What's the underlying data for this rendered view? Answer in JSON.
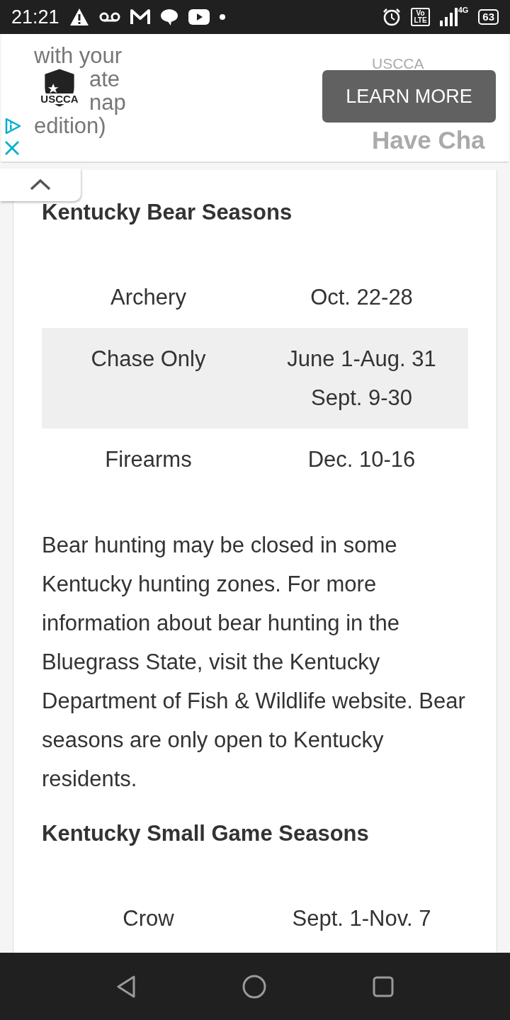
{
  "status_bar": {
    "time": "21:21",
    "volte_top": "Vo",
    "volte_bottom": "LTE",
    "network": "4G",
    "battery": "63"
  },
  "ad": {
    "text_lines": [
      "with your",
      "ate",
      "nap",
      "edition)"
    ],
    "logo_text": "USCCA",
    "advertiser": "USCCA",
    "headline": "Have Cha",
    "button": "LEARN MORE"
  },
  "sections": [
    {
      "heading": "Kentucky Bear Seasons",
      "rows": [
        {
          "name": "Archery",
          "dates": [
            "Oct. 22-28"
          ],
          "shaded": false
        },
        {
          "name": "Chase Only",
          "dates": [
            "June 1-Aug. 31",
            "Sept. 9-30"
          ],
          "shaded": true
        },
        {
          "name": "Firearms",
          "dates": [
            "Dec. 10-16"
          ],
          "shaded": false
        }
      ],
      "paragraph": "Bear hunting may be closed in some Kentucky hunting zones. For more information about bear hunting in the Bluegrass State, visit the Kentucky Department of Fish & Wildlife website. Bear seasons are only open to Kentucky residents."
    },
    {
      "heading": "Kentucky Small Game Seasons",
      "rows": [
        {
          "name": "Crow",
          "dates": [
            "Sept. 1-Nov. 7"
          ],
          "shaded": false
        }
      ]
    }
  ]
}
